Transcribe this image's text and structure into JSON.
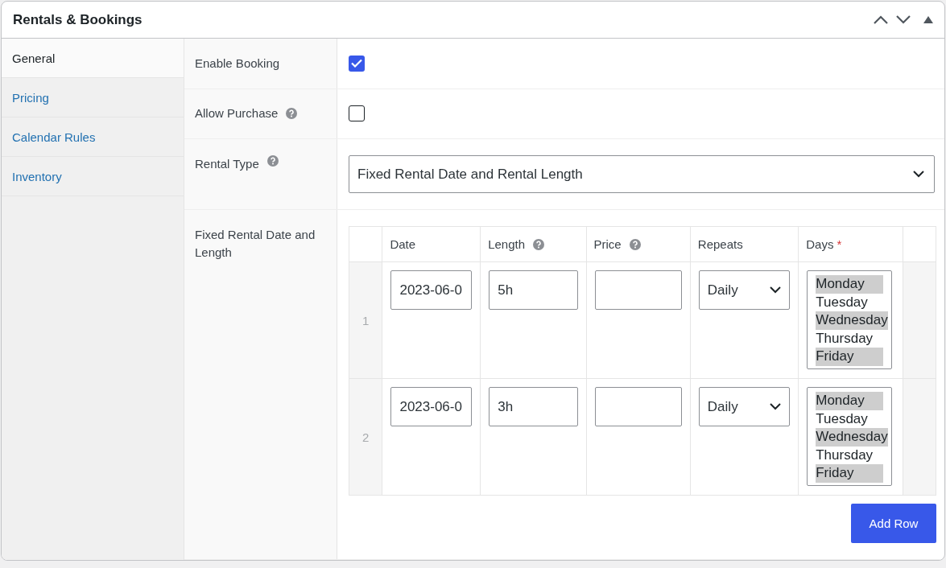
{
  "panel": {
    "title": "Rentals & Bookings"
  },
  "tabs": [
    {
      "label": "General",
      "selected": true
    },
    {
      "label": "Pricing",
      "selected": false
    },
    {
      "label": "Calendar Rules",
      "selected": false
    },
    {
      "label": "Inventory",
      "selected": false
    }
  ],
  "fields": [
    {
      "kind": "checkbox",
      "label": "Enable Booking",
      "help": false,
      "checked": true
    },
    {
      "kind": "checkbox",
      "label": "Allow Purchase",
      "help": true,
      "checked": false
    },
    {
      "kind": "select",
      "label": "Rental Type",
      "help": true,
      "value": "Fixed Rental Date and Rental Length"
    },
    {
      "kind": "table",
      "label": "Fixed Rental Date and Length",
      "help": false
    }
  ],
  "table": {
    "columns": [
      {
        "label": "Date",
        "help": false
      },
      {
        "label": "Length",
        "help": true
      },
      {
        "label": "Price",
        "help": true
      },
      {
        "label": "Repeats",
        "help": false
      },
      {
        "label": "Days",
        "help": false,
        "required_mark": "*"
      }
    ],
    "rows": [
      {
        "index": "1",
        "date": "2023-06-0",
        "length": "5h",
        "repeats": "Daily",
        "days": [
          {
            "label": "Monday",
            "selected": true
          },
          {
            "label": "Tuesday",
            "selected": false
          },
          {
            "label": "Wednesday",
            "selected": true
          },
          {
            "label": "Thursday",
            "selected": false
          },
          {
            "label": "Friday",
            "selected": true
          }
        ]
      },
      {
        "index": "2",
        "date": "2023-06-0",
        "length": "3h",
        "repeats": "Daily",
        "days": [
          {
            "label": "Monday",
            "selected": true
          },
          {
            "label": "Tuesday",
            "selected": false
          },
          {
            "label": "Wednesday",
            "selected": true
          },
          {
            "label": "Thursday",
            "selected": false
          },
          {
            "label": "Friday",
            "selected": true
          }
        ]
      }
    ]
  },
  "add_button": "Add Row"
}
